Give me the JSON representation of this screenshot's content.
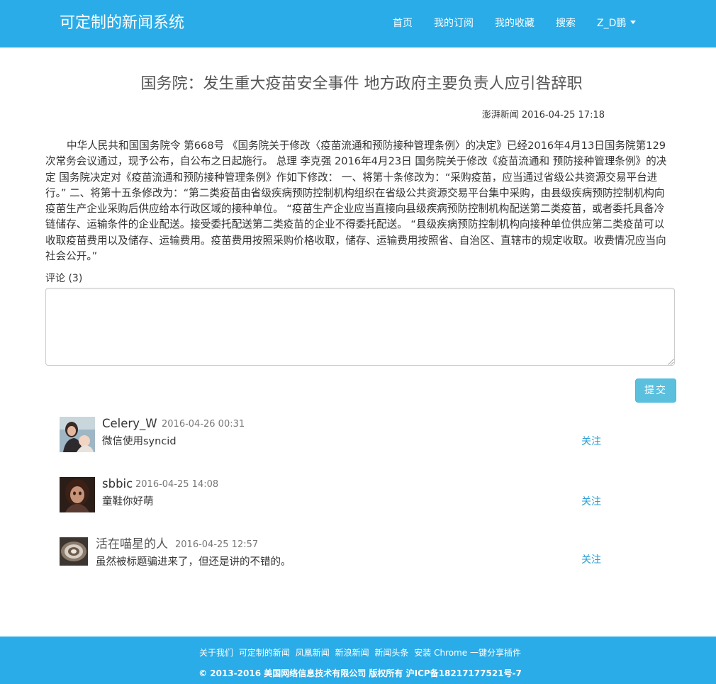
{
  "nav": {
    "brand": "可定制的新闻系统",
    "home": "首页",
    "subscriptions": "我的订阅",
    "favorites": "我的收藏",
    "search": "搜索",
    "user": "Z_D鹏"
  },
  "article": {
    "title": "国务院：发生重大疫苗安全事件 地方政府主要负责人应引咎辞职",
    "source": "澎湃新闻",
    "date": "2016-04-25 17:18",
    "body": "中华人民共和国国务院令 第668号 《国务院关于修改〈疫苗流通和预防接种管理条例〉的决定》已经2016年4月13日国务院第129次常务会议通过，现予公布，自公布之日起施行。 总理 李克强 2016年4月23日 国务院关于修改《疫苗流通和 预防接种管理条例》的决定 国务院决定对《疫苗流通和预防接种管理条例》作如下修改： 一、将第十条修改为：“采购疫苗，应当通过省级公共资源交易平台进行。” 二、将第十五条修改为：“第二类疫苗由省级疾病预防控制机构组织在省级公共资源交易平台集中采购，由县级疾病预防控制机构向疫苗生产企业采购后供应给本行政区域的接种单位。 “疫苗生产企业应当直接向县级疾病预防控制机构配送第二类疫苗，或者委托具备冷链储存、运输条件的企业配送。接受委托配送第二类疫苗的企业不得委托配送。 “县级疾病预防控制机构向接种单位供应第二类疫苗可以收取疫苗费用以及储存、运输费用。疫苗费用按照采购价格收取，储存、运输费用按照省、自治区、直辖市的规定收取。收费情况应当向社会公开。”"
  },
  "comments_section": {
    "label": "评论 (3)",
    "input_value": "",
    "submit_label": "提交"
  },
  "comments": [
    {
      "author": "Celery_W",
      "time": "2016-04-26 00:31",
      "text": "微信使用syncid",
      "follow": "关注"
    },
    {
      "author": "sbbic",
      "time": "2016-04-25 14:08",
      "text": "童鞋你好萌",
      "follow": "关注"
    },
    {
      "author": "活在喵星的人",
      "time": "2016-04-25 12:57",
      "text": "虽然被标题骗进来了，但还是讲的不错的。",
      "follow": "关注"
    }
  ],
  "footer": {
    "links": [
      "关于我们",
      "可定制的新闻",
      "凤凰新闻",
      "新浪新闻",
      "新闻头条",
      "安装 Chrome 一键分享插件"
    ],
    "copyright": "© 2013-2016 美国网络信息技术有限公司 版权所有 沪ICP备18217177521号-7"
  },
  "colors": {
    "brand_blue": "#2aace8",
    "button_info": "#5bc0de",
    "link": "#2a9fd6"
  }
}
